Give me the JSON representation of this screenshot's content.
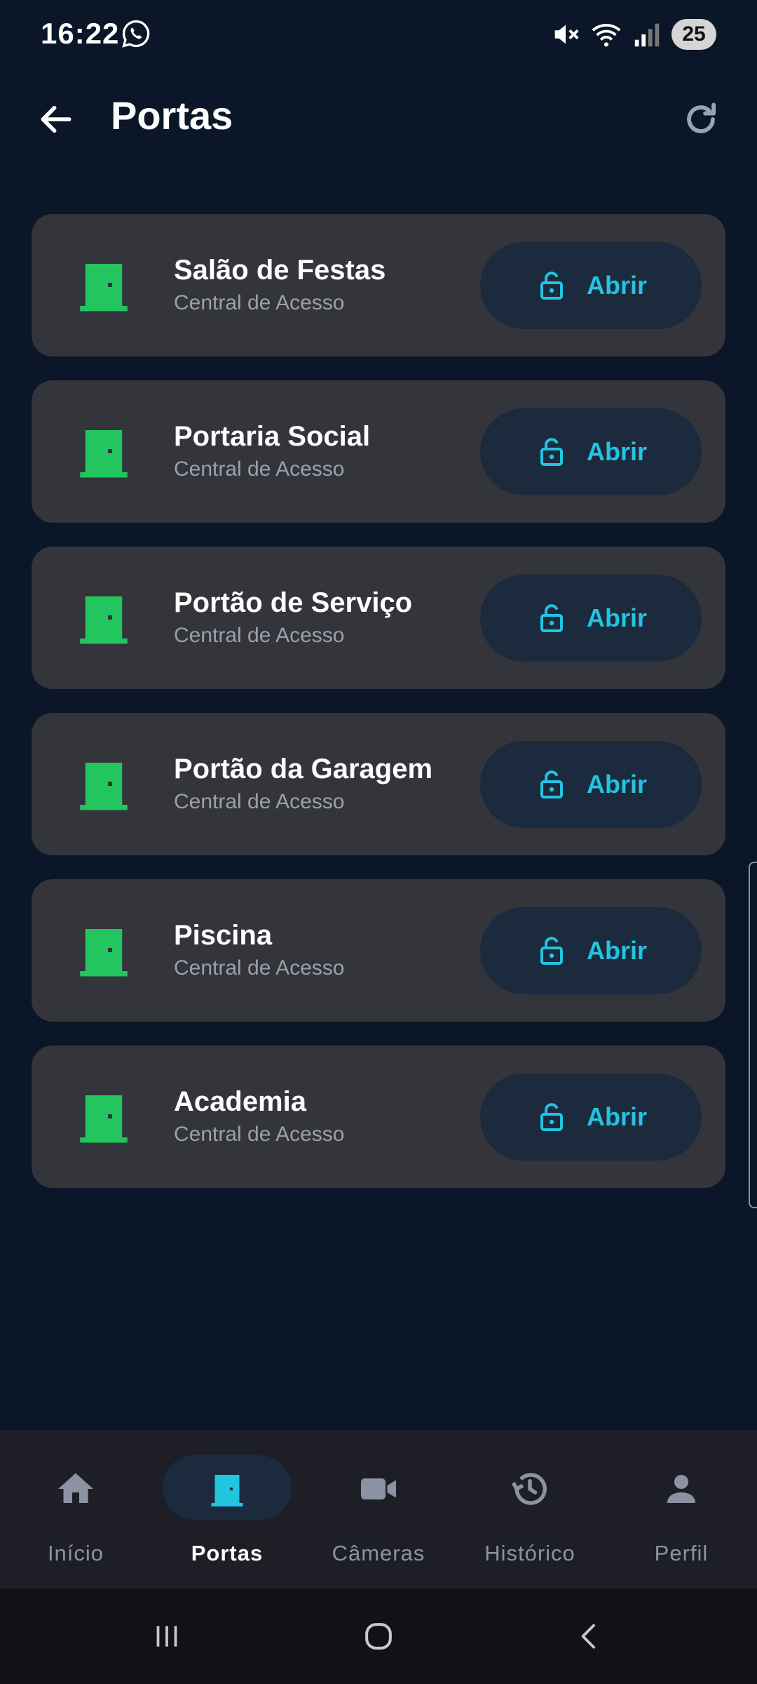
{
  "status_bar": {
    "time": "16:22",
    "battery": "25"
  },
  "app_bar": {
    "title": "Portas"
  },
  "doors": [
    {
      "name": "Salão de Festas",
      "subtitle": "Central de Acesso",
      "action": "Abrir"
    },
    {
      "name": "Portaria Social",
      "subtitle": "Central de Acesso",
      "action": "Abrir"
    },
    {
      "name": "Portão de Serviço",
      "subtitle": "Central de Acesso",
      "action": "Abrir"
    },
    {
      "name": "Portão da Garagem",
      "subtitle": "Central de Acesso",
      "action": "Abrir"
    },
    {
      "name": "Piscina",
      "subtitle": "Central de Acesso",
      "action": "Abrir"
    },
    {
      "name": "Academia",
      "subtitle": "Central de Acesso",
      "action": "Abrir"
    }
  ],
  "bottom_nav": {
    "items": [
      {
        "label": "Início",
        "icon": "home-icon",
        "active": false
      },
      {
        "label": "Portas",
        "icon": "door-icon",
        "active": true
      },
      {
        "label": "Câmeras",
        "icon": "videocam-icon",
        "active": false
      },
      {
        "label": "Histórico",
        "icon": "history-icon",
        "active": false
      },
      {
        "label": "Perfil",
        "icon": "person-icon",
        "active": false
      }
    ]
  },
  "colors": {
    "background": "#0b1628",
    "card": "#34343b",
    "door_green": "#22c55e",
    "accent_cyan": "#22c4e0",
    "button_bg": "#1c2a3e",
    "nav_bg": "#1e1f26"
  }
}
